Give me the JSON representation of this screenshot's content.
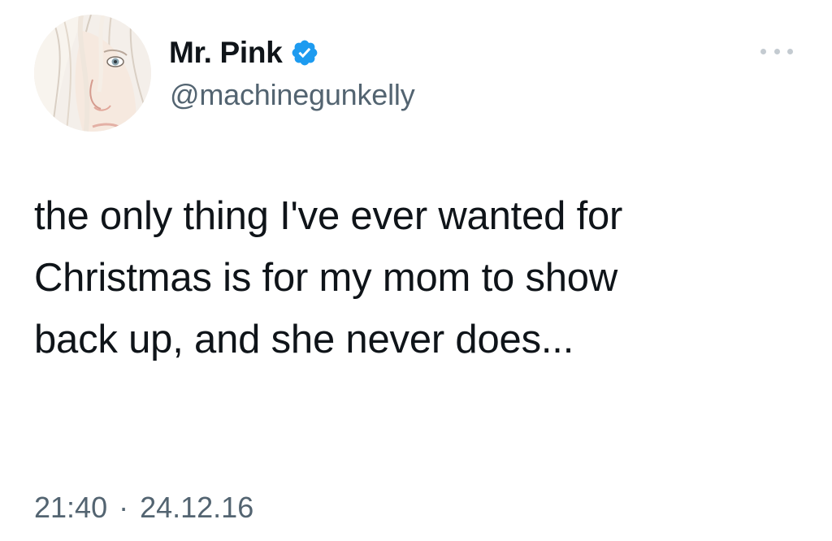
{
  "tweet": {
    "display_name": "Mr. Pink",
    "handle": "@machinegunkelly",
    "verified": true,
    "verified_icon": "verified-badge-icon",
    "more_icon": "more-horizontal-icon",
    "text_lines": [
      "the only thing I've ever wanted for",
      "Christmas is for my mom to show",
      "back up, and she never does..."
    ],
    "time": "21:40",
    "separator": "·",
    "date": "24.12.16"
  },
  "colors": {
    "primary_text": "#0f1419",
    "secondary_text": "#536471",
    "verified_blue": "#1d9bf0",
    "background": "#ffffff"
  }
}
